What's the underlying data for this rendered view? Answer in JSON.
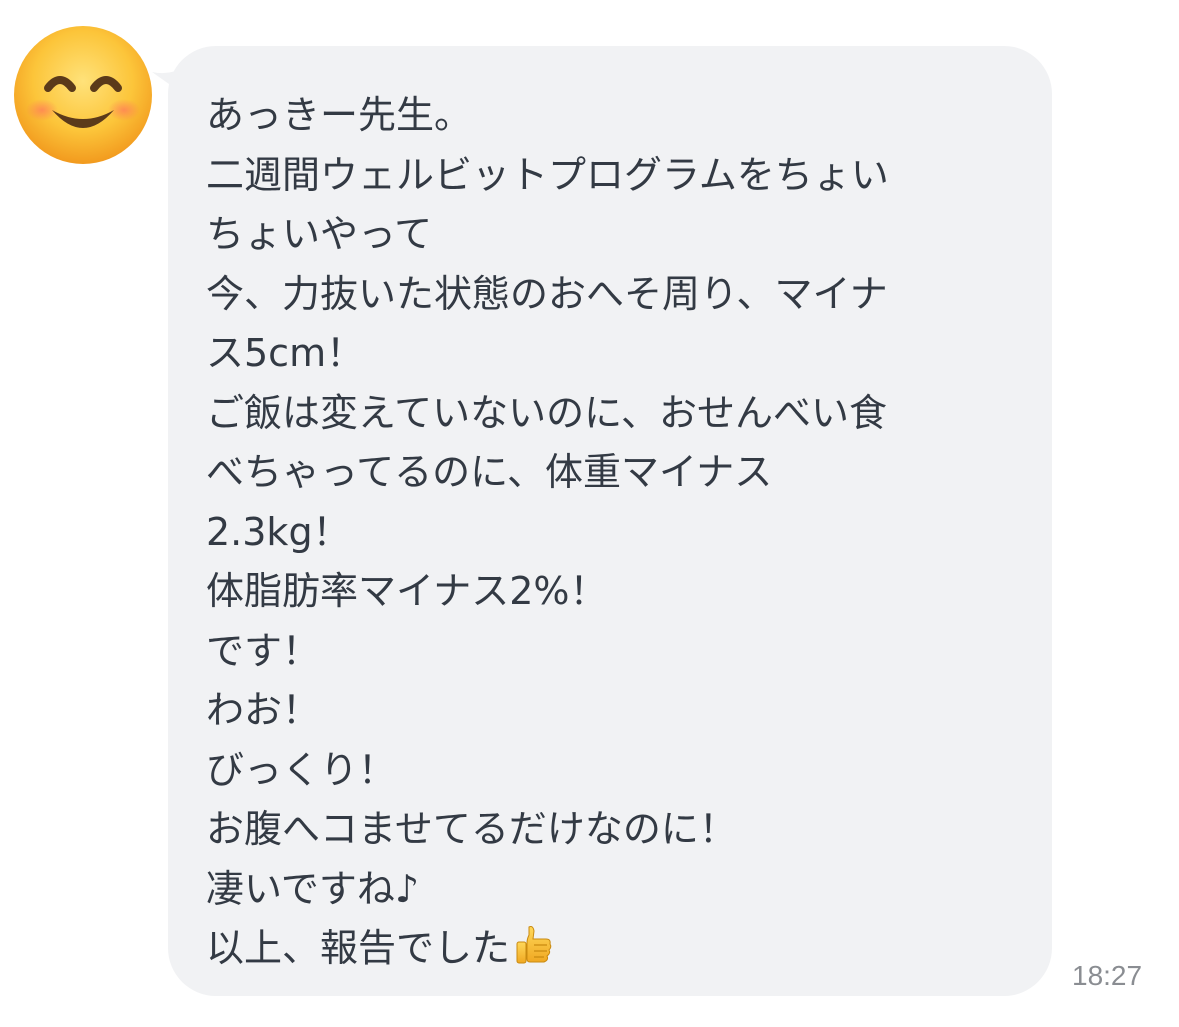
{
  "sender": {
    "avatar_icon": "smiling-face-with-smiling-eyes-icon"
  },
  "message": {
    "lines": [
      "あっきー先生。",
      "二週間ウェルビットプログラムをちょい",
      "ちょいやって",
      "今、力抜いた状態のおへそ周り、マイナ",
      "ス5cm！",
      "ご飯は変えていないのに、おせんべい食",
      "べちゃってるのに、体重マイナス",
      "2.3kg！",
      "体脂肪率マイナス2%！",
      "です！",
      "わお！",
      "びっくり！",
      "お腹へコませてるだけなのに！",
      "凄いですね♪",
      "以上、報告でした"
    ],
    "trailing_icon": "thumbs-up-icon",
    "timestamp": "18:27"
  },
  "colors": {
    "bubble_background": "#f1f2f4",
    "text": "#333a44",
    "timestamp": "#8a8d92"
  }
}
